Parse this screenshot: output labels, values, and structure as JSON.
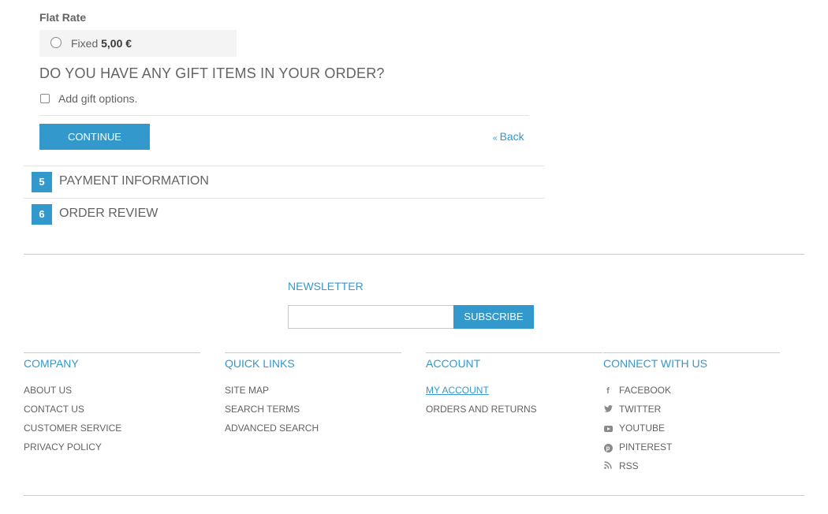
{
  "shipping": {
    "method_title": "Flat Rate",
    "rate_label": "Fixed",
    "rate_price": "5,00 €"
  },
  "gift": {
    "heading": "DO YOU HAVE ANY GIFT ITEMS IN YOUR ORDER?",
    "checkbox_label": "Add gift options."
  },
  "actions": {
    "continue_label": "CONTINUE",
    "back_prefix": "«",
    "back_label": "Back"
  },
  "steps": [
    {
      "number": "5",
      "title": "PAYMENT INFORMATION"
    },
    {
      "number": "6",
      "title": "ORDER REVIEW"
    }
  ],
  "newsletter": {
    "title": "NEWSLETTER",
    "input_value": "",
    "subscribe_label": "SUBSCRIBE"
  },
  "footer": {
    "company": {
      "title": "COMPANY",
      "links": [
        "ABOUT US",
        "CONTACT US",
        "CUSTOMER SERVICE",
        "PRIVACY POLICY"
      ]
    },
    "quick_links": {
      "title": "QUICK LINKS",
      "links": [
        "SITE MAP",
        "SEARCH TERMS",
        "ADVANCED SEARCH"
      ]
    },
    "account": {
      "title": "ACCOUNT",
      "links": [
        "MY ACCOUNT",
        "ORDERS AND RETURNS"
      ]
    },
    "connect": {
      "title": "CONNECT WITH US",
      "links": [
        {
          "icon": "facebook-icon",
          "label": "FACEBOOK"
        },
        {
          "icon": "twitter-icon",
          "label": "TWITTER"
        },
        {
          "icon": "youtube-icon",
          "label": "YOUTUBE"
        },
        {
          "icon": "pinterest-icon",
          "label": "PINTEREST"
        },
        {
          "icon": "rss-icon",
          "label": "RSS"
        }
      ]
    }
  },
  "colors": {
    "accent": "#3399cc",
    "text": "#636363",
    "rate_box_bg": "#f4f4f4"
  }
}
